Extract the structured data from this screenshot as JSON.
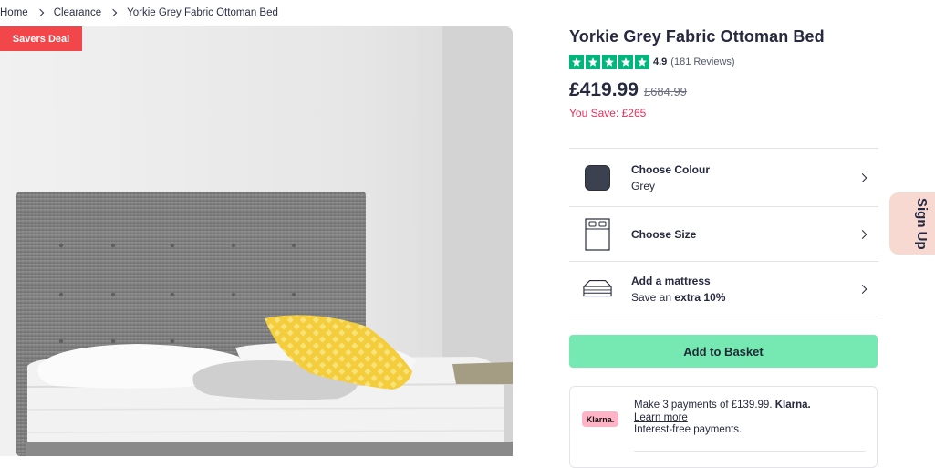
{
  "breadcrumb": [
    "Home",
    "Clearance",
    "Yorkie Grey Fabric Ottoman Bed"
  ],
  "badge": "Savers Deal",
  "product": {
    "title": "Yorkie Grey Fabric Ottoman Bed",
    "rating": "4.9",
    "rating_stars": 5,
    "reviews": "(181 Reviews)",
    "price": "£419.99",
    "was_price": "£684.99",
    "you_save": "You Save: £265"
  },
  "options": {
    "colour": {
      "label": "Choose Colour",
      "value": "Grey",
      "swatch": "#3c4150"
    },
    "size": {
      "label": "Choose Size"
    },
    "mattress": {
      "label": "Add a mattress",
      "value_prefix": "Save an",
      "value_bold": "extra 10%"
    }
  },
  "add_to_basket": "Add to Basket",
  "klarna": {
    "badge": "Klarna.",
    "line1": "Make 3 payments of £139.99.",
    "brand": "Klarna.",
    "learn_more": "Learn more",
    "line3": "Interest-free payments."
  },
  "signup": "Sign Up",
  "colors": {
    "accent_green": "#76e8b1",
    "trustpilot": "#00b67a",
    "save_red": "#e8305a",
    "deal_red": "#f1474b"
  }
}
